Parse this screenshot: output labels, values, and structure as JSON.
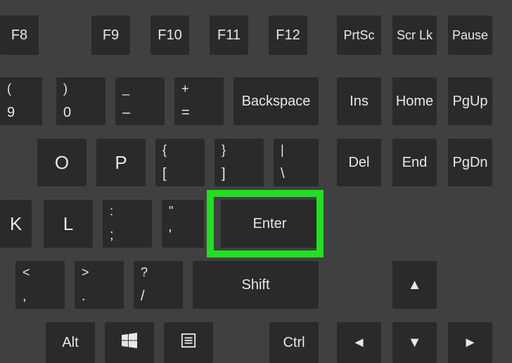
{
  "row_f": {
    "f8": "F8",
    "f9": "F9",
    "f10": "F10",
    "f11": "F11",
    "f12": "F12",
    "prtsc": "PrtSc",
    "scrlk": "Scr Lk",
    "pause": "Pause"
  },
  "row_num": {
    "nine_top": "(",
    "nine_bot": "9",
    "zero_top": ")",
    "zero_bot": "0",
    "minus_top": "_",
    "minus_bot": "–",
    "equals_top": "+",
    "equals_bot": "=",
    "backspace": "Backspace",
    "ins": "Ins",
    "home": "Home",
    "pgup": "PgUp"
  },
  "row_q": {
    "o": "O",
    "p": "P",
    "lbr_top": "{",
    "lbr_bot": "[",
    "rbr_top": "}",
    "rbr_bot": "]",
    "bslash_top": "|",
    "bslash_bot": "\\",
    "del": "Del",
    "end": "End",
    "pgdn": "PgDn"
  },
  "row_a": {
    "k": "K",
    "l": "L",
    "semi_top": ":",
    "semi_bot": ";",
    "quote_top": "\"",
    "quote_bot": "'",
    "enter": "Enter"
  },
  "row_z": {
    "comma_top": "<",
    "comma_bot": ",",
    "period_top": ">",
    "period_bot": ".",
    "slash_top": "?",
    "slash_bot": "/",
    "shift": "Shift",
    "up": "▲"
  },
  "row_b": {
    "alt": "Alt",
    "ctrl": "Ctrl",
    "left": "◄",
    "down": "▼",
    "right": "►"
  }
}
